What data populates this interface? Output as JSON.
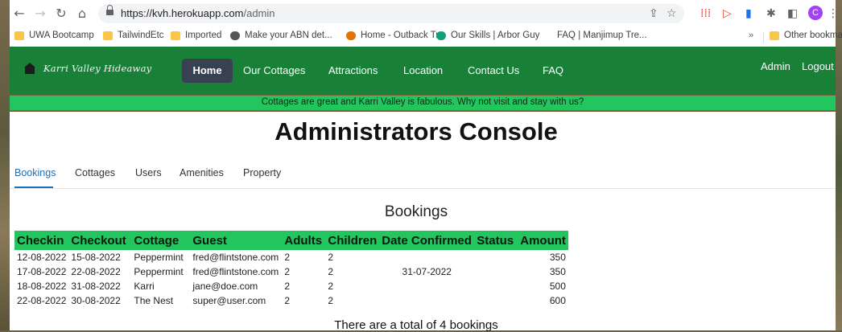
{
  "browser": {
    "url_host": "https://kvh.herokuapp.com",
    "url_path": "/admin",
    "avatar_letter": "C",
    "bookmarks": [
      {
        "label": "UWA Bootcamp",
        "icon": "folder-icon"
      },
      {
        "label": "TailwindEtc",
        "icon": "folder-icon"
      },
      {
        "label": "Imported",
        "icon": "folder-icon"
      },
      {
        "label": "Make your ABN det...",
        "icon": "abn-icon"
      },
      {
        "label": "Home - Outback Tr...",
        "icon": "outback-icon"
      },
      {
        "label": "Our Skills | Arbor Guy",
        "icon": "arbor-icon"
      },
      {
        "label": "FAQ | Manjimup Tre...",
        "icon": "none"
      }
    ],
    "bookmarks_more": "»",
    "other_bookmarks": "Other bookmark"
  },
  "site": {
    "brand": "Karri Valley Hideaway",
    "nav": {
      "home": "Home",
      "cottages": "Our Cottages",
      "attractions": "Attractions",
      "location": "Location",
      "contact": "Contact Us",
      "faq": "FAQ",
      "admin": "Admin",
      "logout": "Logout"
    },
    "banner": "Cottages are great and Karri Valley is fabulous.   Why not visit and stay with us?"
  },
  "admin": {
    "title": "Administrators Console",
    "tabs": [
      "Bookings",
      "Cottages",
      "Users",
      "Amenities",
      "Property"
    ],
    "active_tab": "Bookings",
    "section_title": "Bookings",
    "columns": [
      "Checkin",
      "Checkout",
      "Cottage",
      "Guest",
      "Adults",
      "Children",
      "Date Confirmed",
      "Status",
      "Amount"
    ],
    "rows": [
      [
        "12-08-2022",
        "15-08-2022",
        "Peppermint",
        "fred@flintstone.com",
        "2",
        "2",
        "",
        "",
        "350"
      ],
      [
        "17-08-2022",
        "22-08-2022",
        "Peppermint",
        "fred@flintstone.com",
        "2",
        "2",
        "31-07-2022",
        "",
        "350"
      ],
      [
        "18-08-2022",
        "31-08-2022",
        "Karri",
        "jane@doe.com",
        "2",
        "2",
        "",
        "",
        "500"
      ],
      [
        "22-08-2022",
        "30-08-2022",
        "The Nest",
        "super@user.com",
        "2",
        "2",
        "",
        "",
        "600"
      ]
    ],
    "total_text": "There are a total of 4 bookings"
  },
  "colors": {
    "navbar": "#198038",
    "banner": "#22c55e",
    "table_header": "#22c55e",
    "active_tab": "#1d6fb8",
    "home_button": "#374151"
  }
}
